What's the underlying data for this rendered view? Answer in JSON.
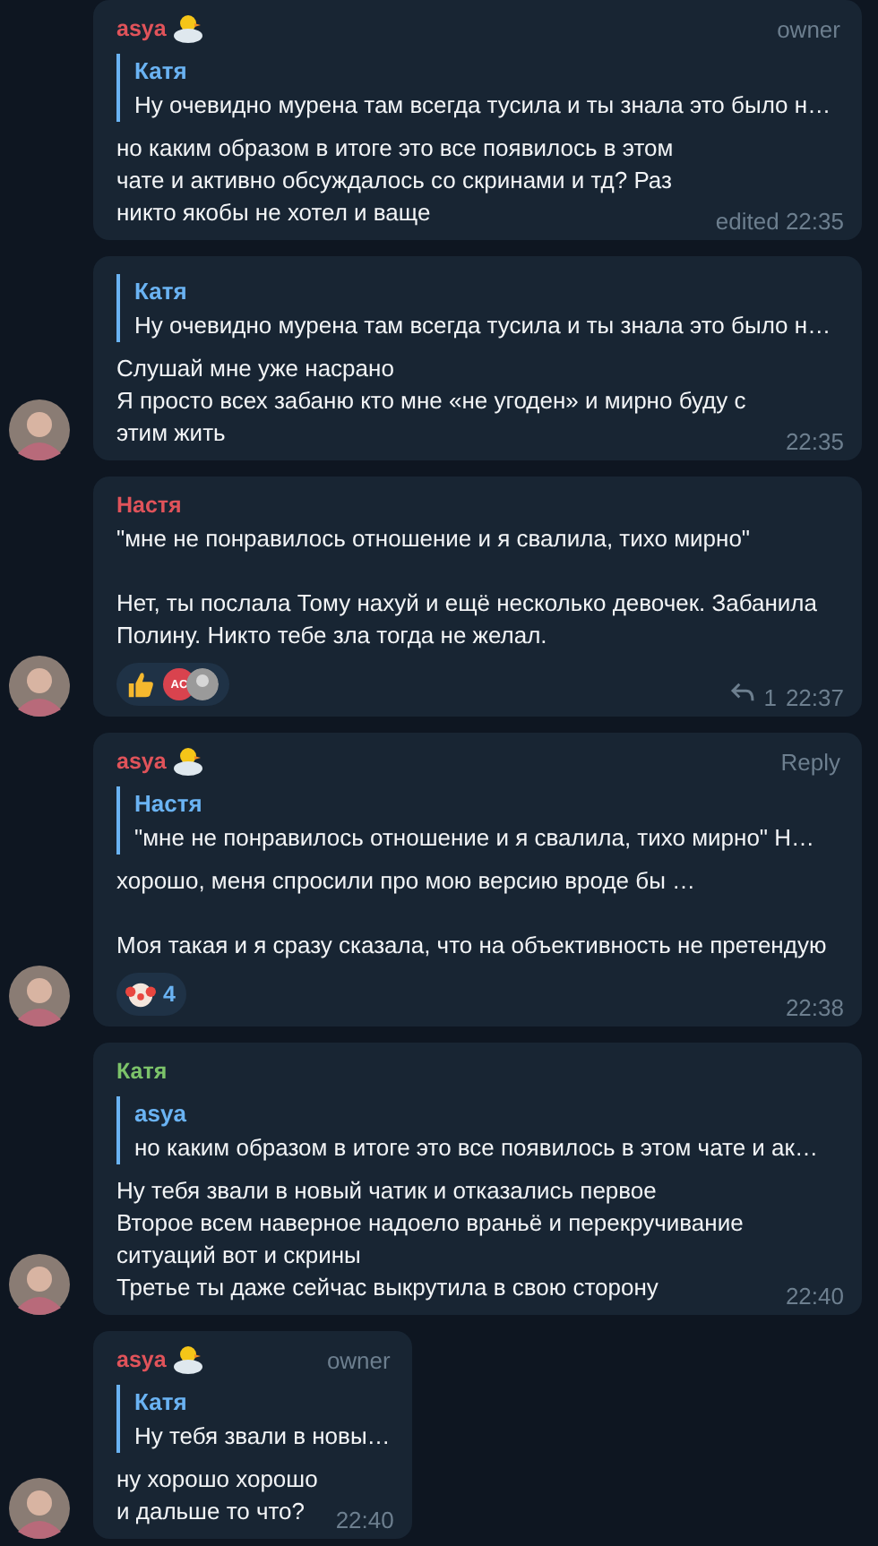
{
  "messages": [
    {
      "sender": "asya",
      "color": "#e0535a",
      "sender_emoji": true,
      "badge": "owner",
      "reply": {
        "author": "Катя",
        "text": "Ну очевидно мурена там всегда тусила и ты знала это было н…"
      },
      "text": "но каким образом в итоге это все появилось в этом чате и активно обсуждалось со скринами и тд? Раз никто якобы не хотел и ваще",
      "time": "edited 22:35",
      "avatar": false,
      "narrow": false
    },
    {
      "reply": {
        "author": "Катя",
        "text": "Ну очевидно мурена там всегда тусила и ты знала это было н…"
      },
      "text": "Слушай мне уже насрано\nЯ просто всех забаню кто мне «не угоден» и мирно буду с этим жить",
      "time": "22:35",
      "avatar": true,
      "narrow": false
    },
    {
      "sender": "Настя",
      "color": "#e0535a",
      "text": "\"мне не понравилось отношение и я свалила, тихо мирно\"\n\nНет, ты послала Тому нахуй и ещё несколько девочек. Забанила Полину. Никто тебе зла тогда не желал.",
      "reactions": [
        {
          "kind": "thumbs-up",
          "reactors": [
            {
              "initials": "AC"
            },
            {
              "kind": "photo"
            }
          ]
        }
      ],
      "replies_count": "1",
      "time": "22:37",
      "avatar": true,
      "narrow": false
    },
    {
      "sender": "asya",
      "color": "#e0535a",
      "sender_emoji": true,
      "badge": "Reply",
      "reply": {
        "author": "Настя",
        "text": "\"мне не понравилось отношение и я свалила, тихо мирно\"  Н…"
      },
      "text": "хорошо, меня спросили про мою версию вроде бы …\n\nМоя такая и я сразу сказала, что на объективность не претендую",
      "reactions": [
        {
          "kind": "clown",
          "count": "4"
        }
      ],
      "time": "22:38",
      "avatar": true,
      "narrow": false
    },
    {
      "sender": "Катя",
      "color": "#7cc36a",
      "reply": {
        "author": "asya",
        "text": "но каким образом в итоге это все появилось в этом чате и ак…"
      },
      "text": "Ну тебя звали в новый чатик и отказались первое\nВторое всем наверное надоело враньё и перекручивание ситуаций вот и скрины\nТретье ты даже сейчас выкрутила в свою сторону",
      "time": "22:40",
      "avatar": true,
      "narrow": false
    },
    {
      "sender": "asya",
      "color": "#e0535a",
      "sender_emoji": true,
      "badge": "owner",
      "narrow": true,
      "reply": {
        "author": "Катя",
        "text": "Ну тебя звали в новы…"
      },
      "text": "ну хорошо хорошо\nи дальше то что?",
      "time": "22:40",
      "avatar": true
    }
  ]
}
